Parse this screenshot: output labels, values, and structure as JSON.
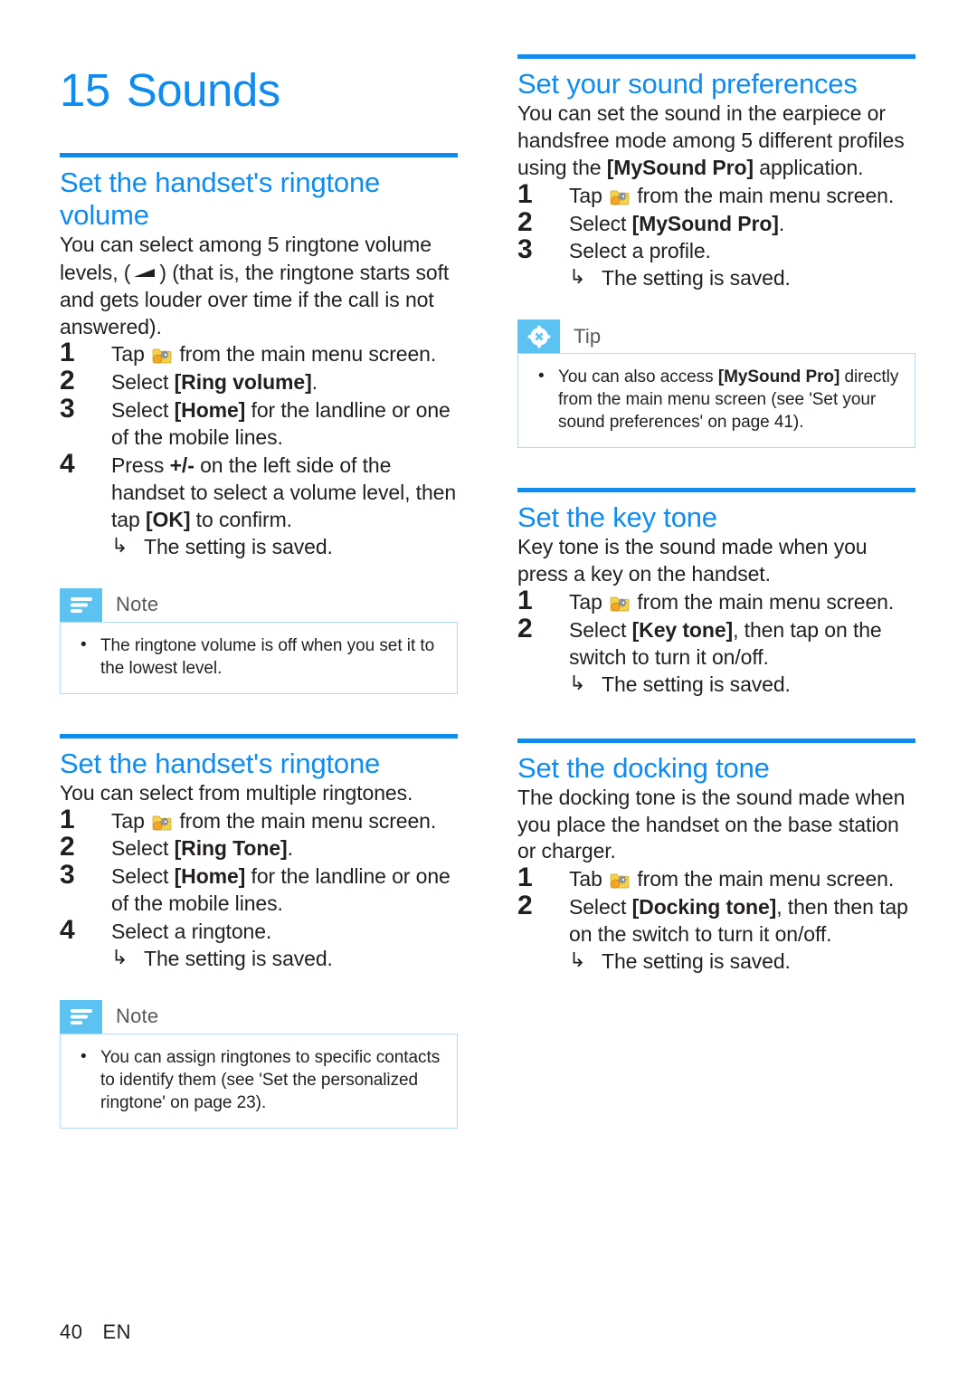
{
  "document": {
    "chapter_number": "15",
    "chapter_title": "Sounds",
    "footer_page_number": "40",
    "footer_language": "EN",
    "accent_color": "#0f8cf0",
    "callout_badge_color": "#5cc2f2",
    "callout_border_color": "#a9dcf5"
  },
  "left_column": {
    "section_volume": {
      "title": "Set the handset's ringtone volume",
      "intro_part_1": "You can select among 5 ringtone volume levels, (",
      "intro_part_2": ") (that is, the ringtone starts soft and gets louder over time if the call is not answered).",
      "icon_crescendo": "crescendo-icon",
      "steps": [
        {
          "num": "1",
          "text_before_icon": "Tap ",
          "icon": "settings-gear-icon",
          "text_after_icon": " from the main menu screen."
        },
        {
          "num": "2",
          "text_before": "Select ",
          "bold": "[Ring volume]",
          "text_after": "."
        },
        {
          "num": "3",
          "text_before": "Select ",
          "bold": "[Home]",
          "text_after": " for the landline or one of the mobile lines."
        },
        {
          "num": "4",
          "text_before": "Press ",
          "bold": "+/-",
          "text_mid": " on the left side of the handset to select a volume level, then tap ",
          "bold2": "[OK]",
          "text_after": " to confirm.",
          "result_arrow": "↳",
          "result": "The setting is saved."
        }
      ]
    },
    "note_volume": {
      "label": "Note",
      "icon": "note-lines-icon",
      "bullets": [
        "The ringtone volume is off when you set it to the lowest level."
      ]
    },
    "section_ringtone": {
      "title": "Set the handset's ringtone",
      "intro": "You can select from multiple ringtones.",
      "steps": [
        {
          "num": "1",
          "text_before_icon": "Tap ",
          "icon": "settings-gear-icon",
          "text_after_icon": " from the main menu screen."
        },
        {
          "num": "2",
          "text_before": "Select ",
          "bold": "[Ring Tone]",
          "text_after": "."
        },
        {
          "num": "3",
          "text_before": "Select ",
          "bold": "[Home]",
          "text_after": " for the landline or one of the mobile lines."
        },
        {
          "num": "4",
          "text_before": "Select a ringtone.",
          "result_arrow": "↳",
          "result": "The setting is saved."
        }
      ]
    },
    "note_ringtone": {
      "label": "Note",
      "icon": "note-lines-icon",
      "bullets": [
        "You can assign ringtones to specific contacts to identify them (see 'Set the personalized ringtone' on page 23)."
      ]
    }
  },
  "right_column": {
    "section_preferences": {
      "title": "Set your sound preferences",
      "intro_before": "You can set the sound in the earpiece or handsfree mode among 5 different profiles using the ",
      "intro_bold": "[MySound Pro]",
      "intro_after": " application.",
      "steps": [
        {
          "num": "1",
          "text_before_icon": "Tap ",
          "icon": "settings-gear-icon",
          "text_after_icon": " from the main menu screen."
        },
        {
          "num": "2",
          "text_before": "Select ",
          "bold": "[MySound Pro]",
          "text_after": "."
        },
        {
          "num": "3",
          "text_before": "Select a profile.",
          "result_arrow": "↳",
          "result": "The setting is saved."
        }
      ]
    },
    "tip_preferences": {
      "label": "Tip",
      "icon": "tip-asterisk-icon",
      "bullet_before": "You can also access ",
      "bullet_bold": "[MySound Pro]",
      "bullet_after": " directly from the main menu screen (see 'Set your sound preferences' on page 41)."
    },
    "section_key_tone": {
      "title": "Set the key tone",
      "intro": "Key tone is the sound made when you press a key on the handset.",
      "steps": [
        {
          "num": "1",
          "text_before_icon": "Tap ",
          "icon": "settings-gear-icon",
          "text_after_icon": " from the main menu screen."
        },
        {
          "num": "2",
          "text_before": "Select ",
          "bold": "[Key tone]",
          "text_after": ", then tap on the switch to turn it on/off.",
          "result_arrow": "↳",
          "result": "The setting is saved."
        }
      ]
    },
    "section_docking_tone": {
      "title": "Set the docking tone",
      "intro": "The docking tone is the sound made when you place the handset on the base station or charger.",
      "steps": [
        {
          "num": "1",
          "text_before_icon": "Tab ",
          "icon": "settings-gear-icon",
          "text_after_icon": " from the main menu screen."
        },
        {
          "num": "2",
          "text_before": "Select ",
          "bold": "[Docking tone]",
          "text_after": ", then then tap on the switch to turn it on/off.",
          "result_arrow": "↳",
          "result": "The setting is saved."
        }
      ]
    }
  }
}
